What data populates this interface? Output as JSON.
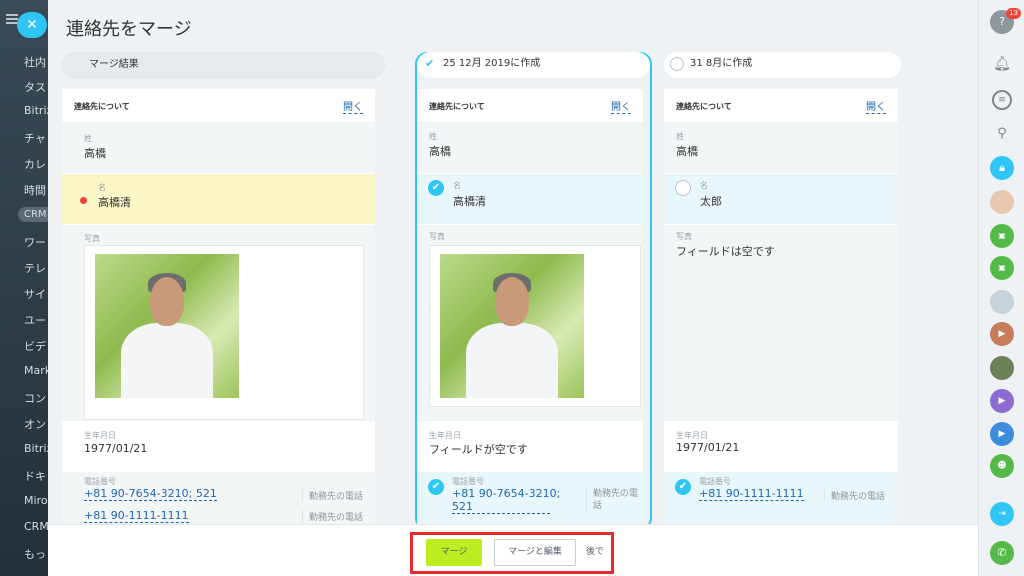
{
  "left_nav": {
    "items": [
      "社内",
      "タス",
      "Bitriz",
      "チャ",
      "カレ",
      "時間",
      "CRM",
      "ワー",
      "テレ",
      "サイ",
      "ユー",
      "ビデ",
      "Mark",
      "コン",
      "オン",
      "Bitriz",
      "ドキ",
      "Miro",
      "CRM",
      "もっ"
    ]
  },
  "page": {
    "title": "連絡先をマージ"
  },
  "columns": {
    "result": {
      "header": "マージ結果"
    },
    "c1": {
      "header": "25 12月 2019に作成"
    },
    "c2": {
      "header": "31 8月に作成"
    }
  },
  "section": {
    "title": "連絡先について",
    "open": "開く"
  },
  "labels": {
    "last_name": "姓",
    "first_name": "名",
    "photo": "写真",
    "birthday": "生年月日",
    "phone": "電話番号"
  },
  "result": {
    "last_name": "高橋",
    "first_name": "高橋清",
    "birthday": "1977/01/21",
    "phones": [
      {
        "number": "+81 90-7654-3210; 521",
        "type": "勤務先の電話"
      },
      {
        "number": "+81 90-1111-1111",
        "type": "勤務先の電話"
      }
    ]
  },
  "c1": {
    "last_name": "高橋",
    "first_name": "高橋清",
    "birthday": "フィールドが空です",
    "phone_line1": "+81 90-7654-3210;",
    "phone_line2": "521",
    "phone_type": "勤務先の電話"
  },
  "c2": {
    "last_name": "高橋",
    "first_name": "太郎",
    "photo_empty": "フィールドは空です",
    "birthday": "1977/01/21",
    "phone": "+81 90-1111-1111",
    "phone_type": "勤務先の電話"
  },
  "buttons": {
    "merge": "マージ",
    "merge_edit": "マージと編集",
    "later": "後で"
  },
  "right_bar": {
    "help_badge": "13"
  },
  "colors": {
    "accent": "#2fc6f6",
    "merge_button": "#bbed21",
    "highlight": "#e62b2b",
    "selected_bg": "#e8f7fc",
    "changed_bg": "#fbf6c6"
  }
}
